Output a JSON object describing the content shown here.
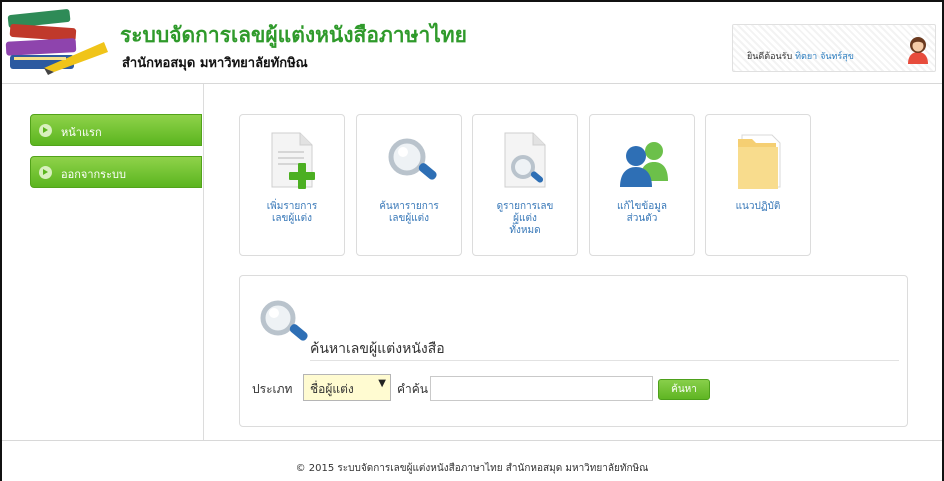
{
  "header": {
    "title": "ระบบจัดการเลขผู้แต่งหนังสือภาษาไทย",
    "subtitle": "สำนักหอสมุด มหาวิทยาลัยทักษิณ",
    "welcome_prefix": "ยินดีต้อนรับ",
    "welcome_name": "ทิตยา จันทร์สุข",
    "logo_icon": "books-stack-logo",
    "avatar_icon": "female-user-avatar-icon"
  },
  "sidebar": {
    "items": [
      {
        "label": "หน้าแรก"
      },
      {
        "label": "ออกจากระบบ"
      }
    ]
  },
  "tiles": [
    {
      "label_lines": [
        "เพิ่มรายการ",
        "เลขผู้แต่ง"
      ],
      "icon": "add-document-icon"
    },
    {
      "label_lines": [
        "ค้นหารายการ",
        "เลขผู้แต่ง"
      ],
      "icon": "magnifier-icon"
    },
    {
      "label_lines": [
        "ดูรายการเลข",
        "ผู้แต่ง",
        "ทั้งหมด"
      ],
      "icon": "document-search-icon"
    },
    {
      "label_lines": [
        "แก้ไขข้อมูล",
        "ส่วนตัว"
      ],
      "icon": "users-icon"
    },
    {
      "label_lines": [
        "แนวปฏิบัติ"
      ],
      "icon": "folder-icon"
    }
  ],
  "search": {
    "heading": "ค้นหาเลขผู้แต่งหนังสือ",
    "type_label": "ประเภท",
    "type_selected": "ชื่อผู้แต่ง",
    "term_label": "คำค้น",
    "term_value": "",
    "button_label": "ค้นหา"
  },
  "footer": {
    "text": "© 2015 ระบบจัดการเลขผู้แต่งหนังสือภาษาไทย สำนักหอสมุด มหาวิทยาลัยทักษิณ"
  },
  "colors": {
    "accent_green": "#5bb51f",
    "title_green": "#2f9a2b",
    "link_blue": "#3878b8"
  }
}
